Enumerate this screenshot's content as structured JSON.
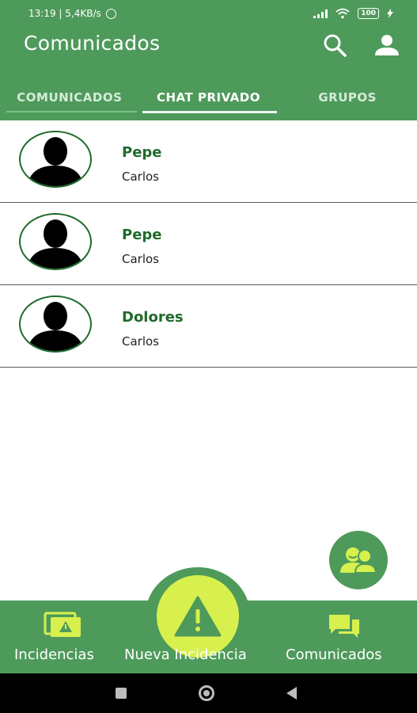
{
  "status_bar": {
    "time_speed": "13:19 | 5,4KB/s",
    "battery": "100"
  },
  "app_bar": {
    "title": "Comunicados"
  },
  "tabs": [
    {
      "label": "COMUNICADOS",
      "active": false
    },
    {
      "label": "CHAT PRIVADO",
      "active": true
    },
    {
      "label": "GRUPOS",
      "active": false
    }
  ],
  "chats": [
    {
      "name": "Pepe",
      "subtitle": "Carlos"
    },
    {
      "name": "Pepe",
      "subtitle": "Carlos"
    },
    {
      "name": "Dolores",
      "subtitle": "Carlos"
    }
  ],
  "bottom_nav": {
    "left_label": "Incidencias",
    "center_label": "Nueva Incidencia",
    "right_label": "Comunicados"
  },
  "colors": {
    "primary_green": "#4e9a5b",
    "dark_green_text": "#1e6b2b",
    "accent_yellow": "#d7f04e"
  }
}
